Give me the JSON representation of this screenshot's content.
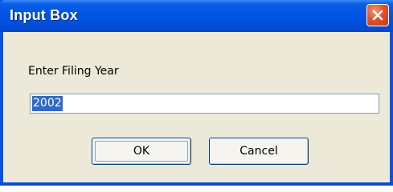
{
  "window": {
    "title": "Input Box"
  },
  "dialog": {
    "prompt": "Enter Filing Year",
    "input_value": "2002",
    "ok_label": "OK",
    "cancel_label": "Cancel"
  },
  "icons": {
    "close": "close-icon"
  },
  "colors": {
    "titlebar": "#0054e3",
    "client_background": "#ece9d8",
    "selection": "#316ac5",
    "close_button": "#e0532b"
  }
}
